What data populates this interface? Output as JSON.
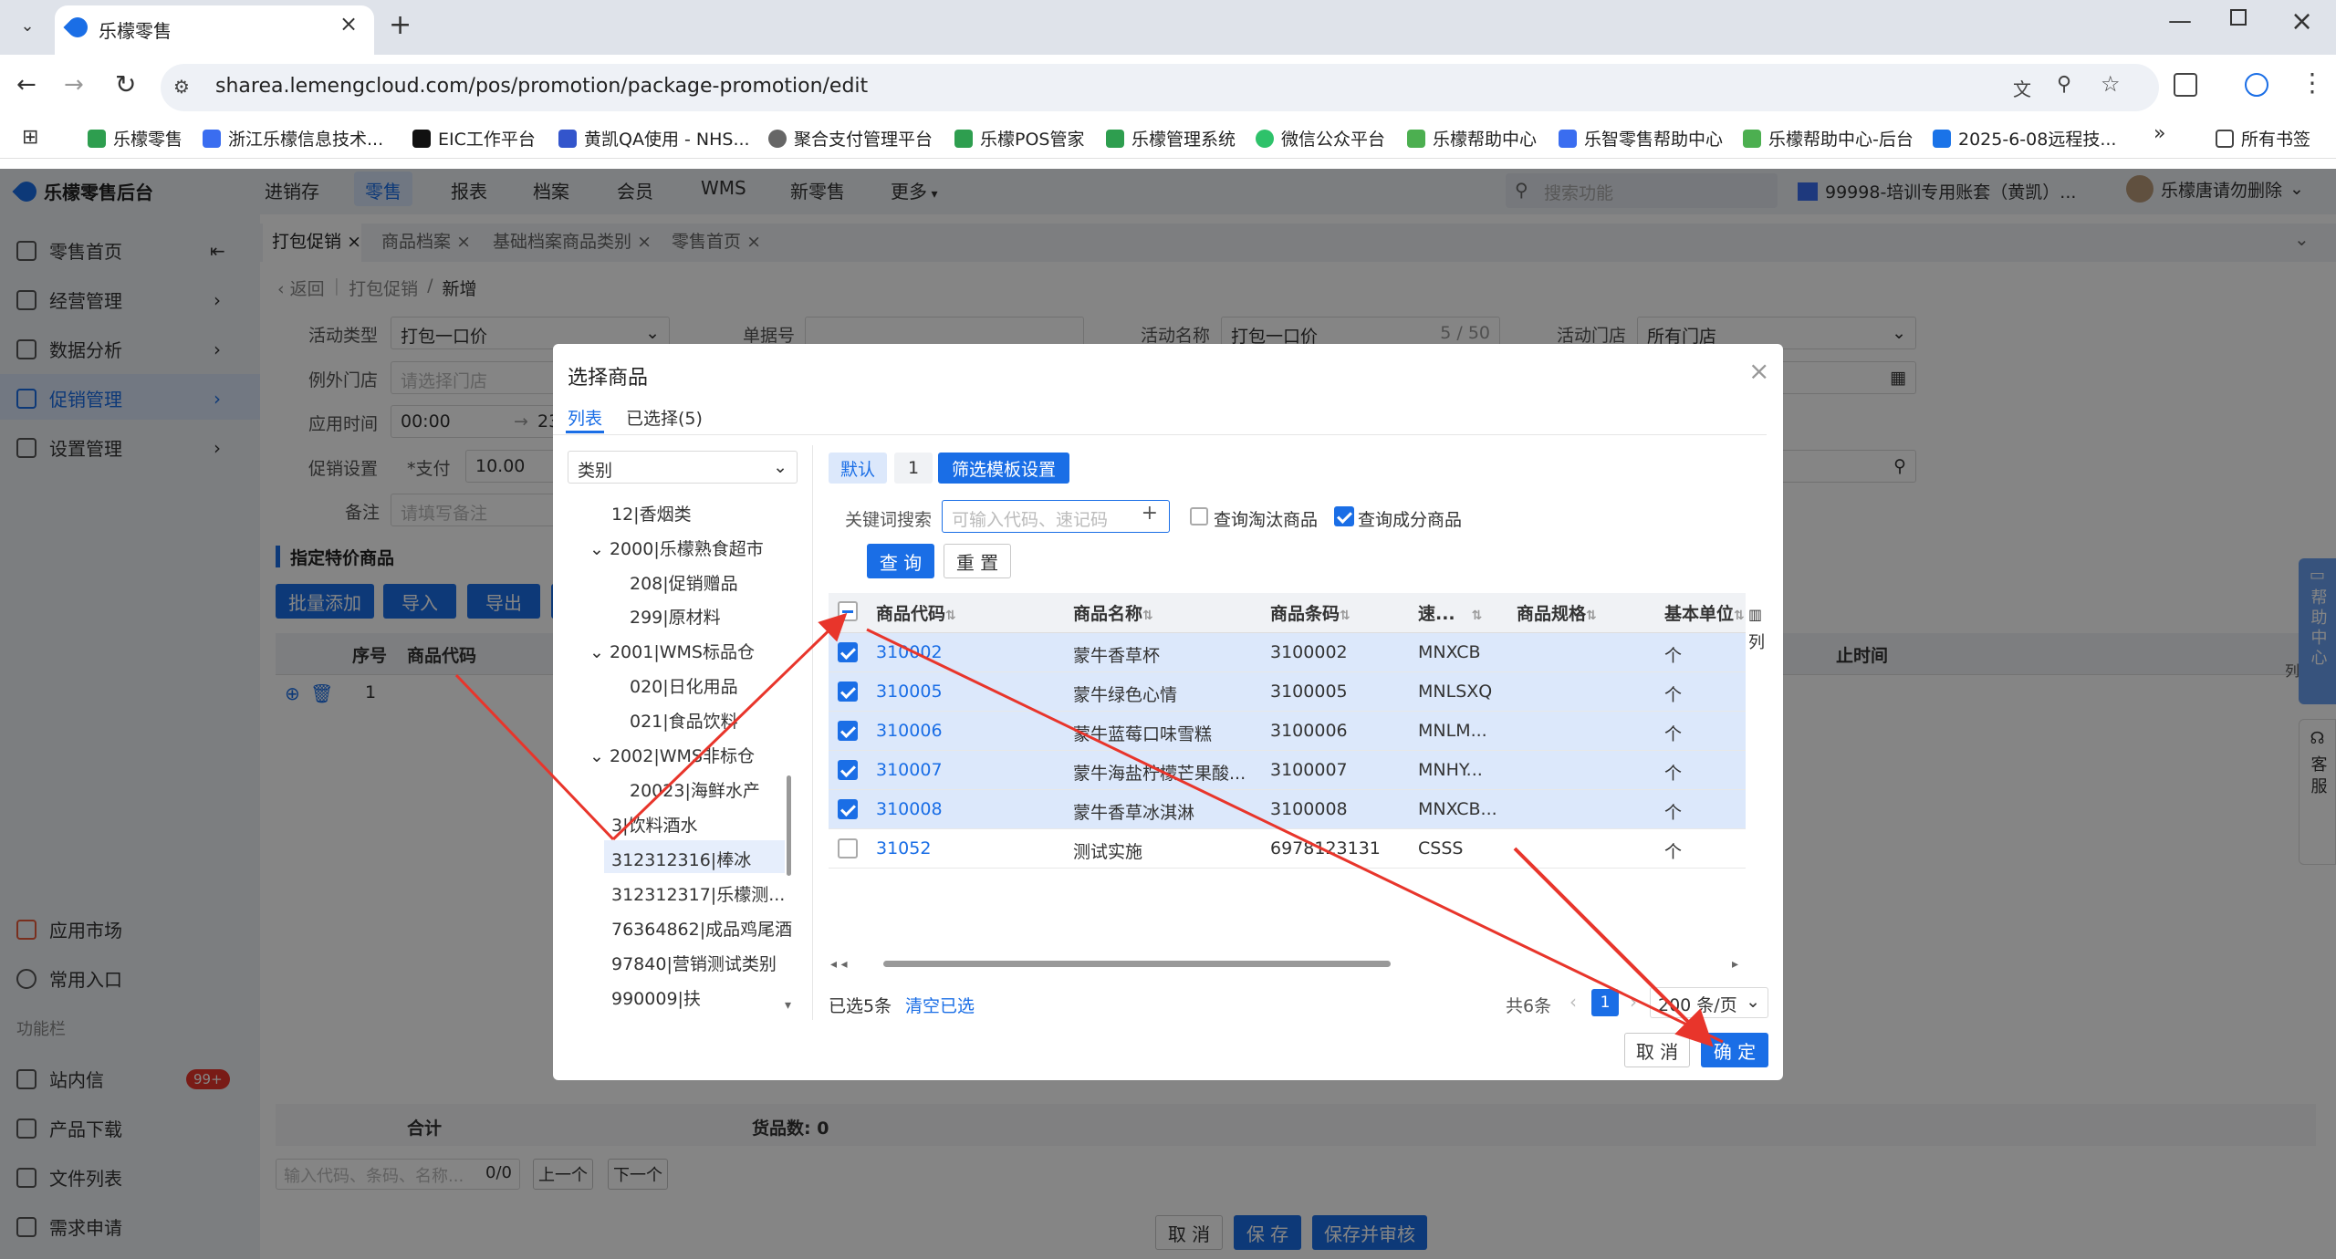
{
  "browser": {
    "tab_title": "乐檬零售",
    "url": "sharea.lemengcloud.com/pos/promotion/package-promotion/edit",
    "bookmarks": [
      "乐檬零售",
      "浙江乐檬信息技术...",
      "EIC工作平台",
      "黄凯QA使用 - NHS...",
      "聚合支付管理平台",
      "乐檬POS管家",
      "乐檬管理系统",
      "微信公众平台",
      "乐檬帮助中心",
      "乐智零售帮助中心",
      "乐檬帮助中心-后台",
      "2025-6-08远程技..."
    ],
    "all_bookmarks": "所有书签"
  },
  "app": {
    "brand": "乐檬零售后台",
    "nav": [
      "进销存",
      "零售",
      "报表",
      "档案",
      "会员",
      "WMS",
      "新零售",
      "更多"
    ],
    "search_placeholder": "搜索功能",
    "account": "99998-培训专用账套（黄凯）...",
    "user": "乐檬唐请勿删除"
  },
  "sidebar": {
    "items": [
      "零售首页",
      "经营管理",
      "数据分析",
      "促销管理",
      "设置管理"
    ],
    "bottom": [
      "应用市场",
      "常用入口"
    ],
    "section": "功能栏",
    "tools": [
      "站内信",
      "产品下载",
      "文件列表",
      "需求申请"
    ],
    "badge": "99+"
  },
  "pagetabs": [
    "打包促销",
    "商品档案",
    "基础档案商品类别",
    "零售首页"
  ],
  "breadcrumb": {
    "back": "返回",
    "path1": "打包促销",
    "sep": "/",
    "current": "新增"
  },
  "form": {
    "activity_type_label": "活动类型",
    "activity_type_value": "打包一口价",
    "doc_no_label": "单据号",
    "activity_name_label": "活动名称",
    "activity_name_value": "打包一口价",
    "activity_name_count": "5 / 50",
    "store_label": "活动门店",
    "store_value": "所有门店",
    "except_store_label": "例外门店",
    "except_store_placeholder": "请选择门店",
    "time_label": "应用时间",
    "time_start": "00:00",
    "time_end": "23",
    "promo_label": "促销设置",
    "pay_label": "*支付",
    "pay_value": "10.00",
    "remark_label": "备注",
    "remark_placeholder": "请填写备注"
  },
  "section_title": "指定特价商品",
  "actions": [
    "批量添加",
    "导入",
    "导出"
  ],
  "main_table": {
    "headers": [
      "序号",
      "商品代码"
    ],
    "row_no": "1",
    "end_time_header": "止时间",
    "col_label": "列",
    "total_label": "合计",
    "goods_count": "货品数: 0"
  },
  "search_bottom": {
    "placeholder": "输入代码、条码、名称...",
    "count": "0/0",
    "prev": "上一个",
    "next": "下一个"
  },
  "footer_buttons": [
    "取 消",
    "保 存",
    "保存并审核"
  ],
  "float": {
    "help": "帮助中心",
    "service": "客服"
  },
  "dialog": {
    "title": "选择商品",
    "tabs": [
      "列表",
      "已选择(5)"
    ],
    "category_select": "类别",
    "tree": [
      "12|香烟类",
      "2000|乐檬熟食超市",
      "208|促销赠品",
      "299|原材料",
      "2001|WMS标品仓",
      "020|日化用品",
      "021|食品饮料",
      "2002|WMS非标仓",
      "20023|海鲜水产",
      "3|饮料酒水",
      "312312316|棒冰",
      "312312317|乐檬测...",
      "76364862|成品鸡尾酒",
      "97840|营销测试类别",
      "990009|扶"
    ],
    "filter_tabs": [
      "默认",
      "1",
      "筛选模板设置"
    ],
    "keyword_label": "关键词搜索",
    "keyword_placeholder": "可输入代码、速记码",
    "check_obsolete": "查询淘汰商品",
    "check_component": "查询成分商品",
    "query_btn": "查 询",
    "reset_btn": "重 置",
    "headers": [
      "商品代码",
      "商品名称",
      "商品条码",
      "速...",
      "商品规格",
      "基本单位"
    ],
    "col_label": "列",
    "rows": [
      {
        "code": "310002",
        "name": "蒙牛香草杯",
        "barcode": "3100002",
        "short": "MNXCB",
        "spec": "",
        "unit": "个",
        "checked": true
      },
      {
        "code": "310005",
        "name": "蒙牛绿色心情",
        "barcode": "3100005",
        "short": "MNLSXQ",
        "spec": "",
        "unit": "个",
        "checked": true
      },
      {
        "code": "310006",
        "name": "蒙牛蓝莓口味雪糕",
        "barcode": "3100006",
        "short": "MNLM...",
        "spec": "",
        "unit": "个",
        "checked": true
      },
      {
        "code": "310007",
        "name": "蒙牛海盐柠檬芒果酸...",
        "barcode": "3100007",
        "short": "MNHY...",
        "spec": "",
        "unit": "个",
        "checked": true
      },
      {
        "code": "310008",
        "name": "蒙牛香草冰淇淋",
        "barcode": "3100008",
        "short": "MNXCB...",
        "spec": "",
        "unit": "个",
        "checked": true
      },
      {
        "code": "31052",
        "name": "测试实施",
        "barcode": "6978123131",
        "short": "CSSS",
        "spec": "",
        "unit": "个",
        "checked": false
      }
    ],
    "selected_count": "已选5条",
    "clear_selected": "清空已选",
    "total": "共6条",
    "page": "1",
    "page_size": "200 条/页",
    "cancel": "取 消",
    "confirm": "确 定"
  },
  "colors": {
    "primary": "#1a6ee6",
    "arrow": "#e8352b",
    "sidebar_bg": "#eef1f6"
  }
}
